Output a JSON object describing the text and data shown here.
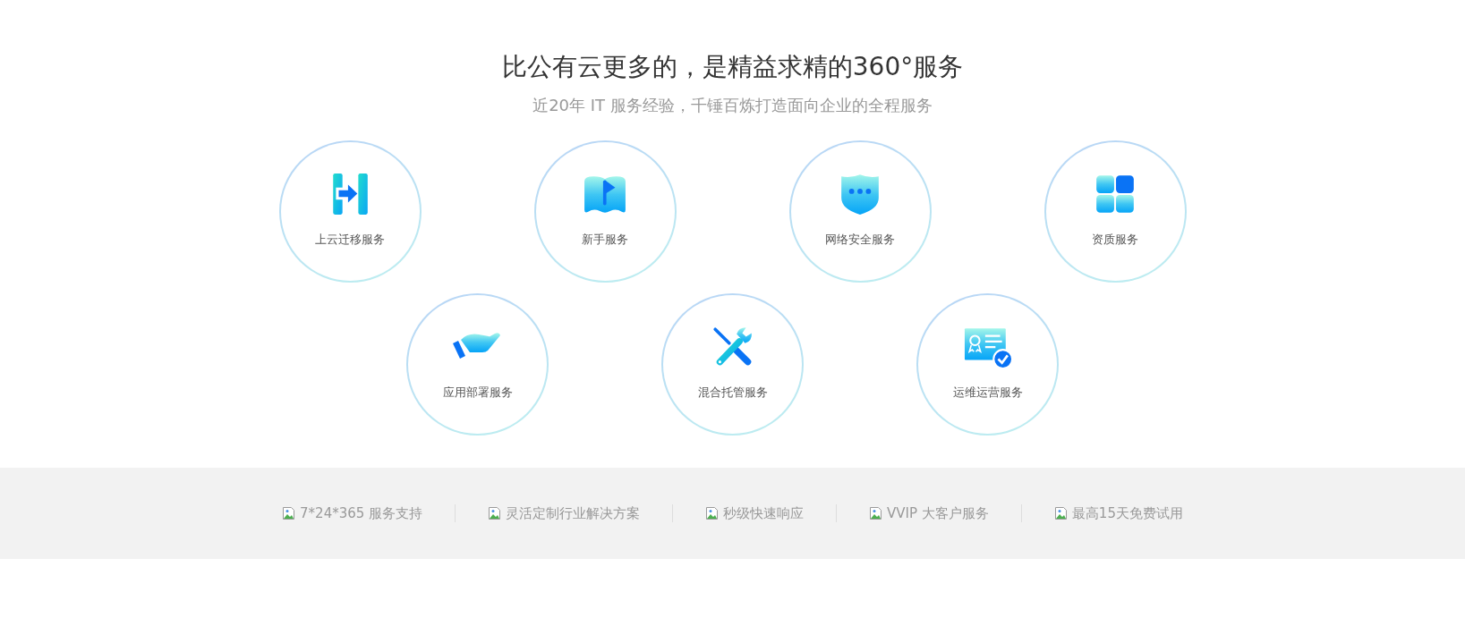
{
  "heading": "比公有云更多的，是精益求精的360°服务",
  "subheading": "近20年 IT 服务经验，千锤百炼打造面向企业的全程服务",
  "services": [
    {
      "label": "上云迁移服务"
    },
    {
      "label": "新手服务"
    },
    {
      "label": "网络安全服务"
    },
    {
      "label": "资质服务"
    },
    {
      "label": "应用部署服务"
    },
    {
      "label": "混合托管服务"
    },
    {
      "label": "运维运营服务"
    }
  ],
  "features": [
    {
      "label": "7*24*365 服务支持"
    },
    {
      "label": "灵活定制行业解决方案"
    },
    {
      "label": "秒级快速响应"
    },
    {
      "label": "VVIP 大客户服务"
    },
    {
      "label": "最高15天免费试用"
    }
  ]
}
